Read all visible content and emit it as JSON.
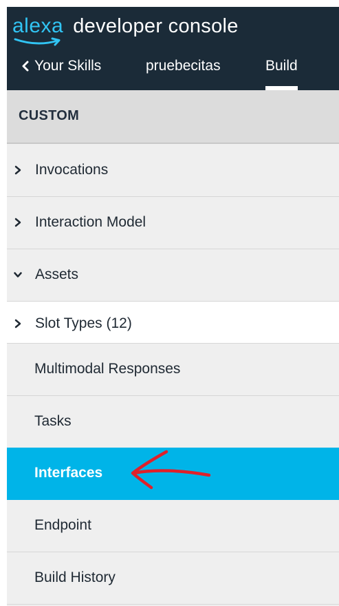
{
  "header": {
    "logo_text": "alexa",
    "title": "developer console",
    "nav": {
      "back_label": "Your Skills",
      "skill_name": "pruebecitas",
      "active_tab": "Build"
    }
  },
  "sidebar": {
    "section_title": "CUSTOM",
    "items": [
      {
        "label": "Invocations",
        "chevron": "right"
      },
      {
        "label": "Interaction Model",
        "chevron": "right"
      },
      {
        "label": "Assets",
        "chevron": "down"
      },
      {
        "label": "Slot Types (12)",
        "chevron": "right"
      },
      {
        "label": "Multimodal Responses"
      },
      {
        "label": "Tasks"
      },
      {
        "label": "Interfaces",
        "selected": true
      },
      {
        "label": "Endpoint"
      },
      {
        "label": "Build History"
      }
    ]
  },
  "colors": {
    "header_bg": "#1b2b38",
    "logo_blue": "#31c4f3",
    "selected_bg": "#00b4e8",
    "annotation_red": "#e0202a"
  }
}
